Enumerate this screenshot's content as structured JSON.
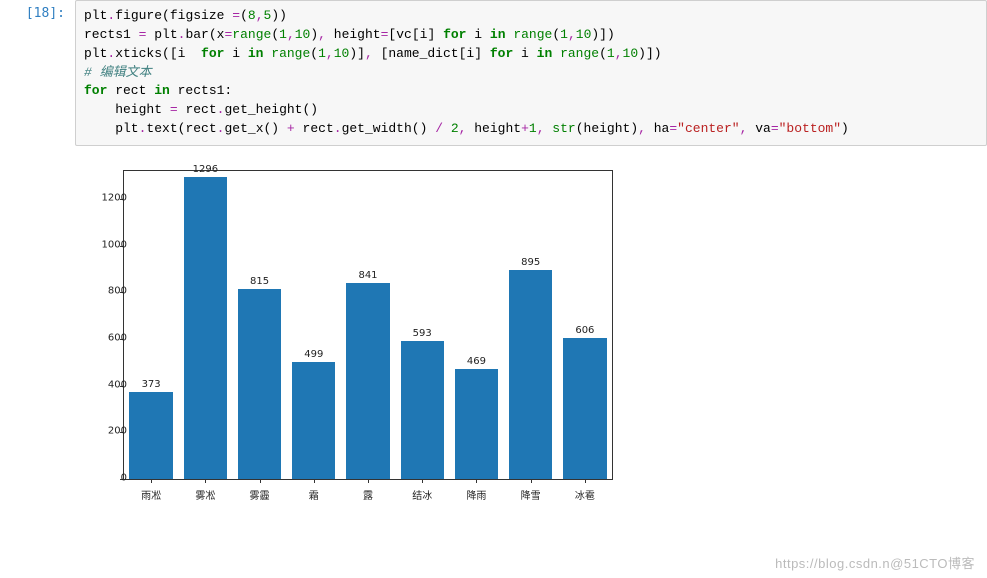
{
  "cell": {
    "prompt": "[18]:",
    "code_tokens": [
      [
        [
          "nm",
          "plt"
        ],
        [
          "op",
          "."
        ],
        [
          "fn",
          "figure"
        ],
        [
          "paren",
          "("
        ],
        [
          "nm",
          "figsize "
        ],
        [
          "op",
          "="
        ],
        [
          "paren",
          "("
        ],
        [
          "num",
          "8"
        ],
        [
          "op",
          ","
        ],
        [
          "num",
          "5"
        ],
        [
          "paren",
          "))"
        ]
      ],
      [
        [
          "nm",
          "rects1 "
        ],
        [
          "op",
          "="
        ],
        [
          "nm",
          " plt"
        ],
        [
          "op",
          "."
        ],
        [
          "fn",
          "bar"
        ],
        [
          "paren",
          "("
        ],
        [
          "nm",
          "x"
        ],
        [
          "op",
          "="
        ],
        [
          "builtin",
          "range"
        ],
        [
          "paren",
          "("
        ],
        [
          "num",
          "1"
        ],
        [
          "op",
          ","
        ],
        [
          "num",
          "10"
        ],
        [
          "paren",
          ")"
        ],
        [
          "op",
          ", "
        ],
        [
          "nm",
          "height"
        ],
        [
          "op",
          "="
        ],
        [
          "paren",
          "["
        ],
        [
          "nm",
          "vc"
        ],
        [
          "paren",
          "["
        ],
        [
          "nm",
          "i"
        ],
        [
          "paren",
          "]"
        ],
        [
          "nm",
          " "
        ],
        [
          "kw",
          "for"
        ],
        [
          "nm",
          " i "
        ],
        [
          "kw",
          "in"
        ],
        [
          "nm",
          " "
        ],
        [
          "builtin",
          "range"
        ],
        [
          "paren",
          "("
        ],
        [
          "num",
          "1"
        ],
        [
          "op",
          ","
        ],
        [
          "num",
          "10"
        ],
        [
          "paren",
          ")])"
        ]
      ],
      [
        [
          "nm",
          "plt"
        ],
        [
          "op",
          "."
        ],
        [
          "fn",
          "xticks"
        ],
        [
          "paren",
          "(["
        ],
        [
          "nm",
          "i  "
        ],
        [
          "kw",
          "for"
        ],
        [
          "nm",
          " i "
        ],
        [
          "kw",
          "in"
        ],
        [
          "nm",
          " "
        ],
        [
          "builtin",
          "range"
        ],
        [
          "paren",
          "("
        ],
        [
          "num",
          "1"
        ],
        [
          "op",
          ","
        ],
        [
          "num",
          "10"
        ],
        [
          "paren",
          ")]"
        ],
        [
          "op",
          ", "
        ],
        [
          "paren",
          "["
        ],
        [
          "nm",
          "name_dict"
        ],
        [
          "paren",
          "["
        ],
        [
          "nm",
          "i"
        ],
        [
          "paren",
          "]"
        ],
        [
          "nm",
          " "
        ],
        [
          "kw",
          "for"
        ],
        [
          "nm",
          " i "
        ],
        [
          "kw",
          "in"
        ],
        [
          "nm",
          " "
        ],
        [
          "builtin",
          "range"
        ],
        [
          "paren",
          "("
        ],
        [
          "num",
          "1"
        ],
        [
          "op",
          ","
        ],
        [
          "num",
          "10"
        ],
        [
          "paren",
          ")])"
        ]
      ],
      [
        [
          "cmt",
          "# 编辑文本"
        ]
      ],
      [
        [
          "kw",
          "for"
        ],
        [
          "nm",
          " rect "
        ],
        [
          "kw",
          "in"
        ],
        [
          "nm",
          " rects1:"
        ]
      ],
      [
        [
          "nm",
          "    height "
        ],
        [
          "op",
          "="
        ],
        [
          "nm",
          " rect"
        ],
        [
          "op",
          "."
        ],
        [
          "fn",
          "get_height"
        ],
        [
          "paren",
          "()"
        ]
      ],
      [
        [
          "nm",
          "    plt"
        ],
        [
          "op",
          "."
        ],
        [
          "fn",
          "text"
        ],
        [
          "paren",
          "("
        ],
        [
          "nm",
          "rect"
        ],
        [
          "op",
          "."
        ],
        [
          "fn",
          "get_x"
        ],
        [
          "paren",
          "()"
        ],
        [
          "nm",
          " "
        ],
        [
          "op",
          "+"
        ],
        [
          "nm",
          " rect"
        ],
        [
          "op",
          "."
        ],
        [
          "fn",
          "get_width"
        ],
        [
          "paren",
          "()"
        ],
        [
          "nm",
          " "
        ],
        [
          "op",
          "/"
        ],
        [
          "nm",
          " "
        ],
        [
          "num",
          "2"
        ],
        [
          "op",
          ", "
        ],
        [
          "nm",
          "height"
        ],
        [
          "op",
          "+"
        ],
        [
          "num",
          "1"
        ],
        [
          "op",
          ", "
        ],
        [
          "builtin",
          "str"
        ],
        [
          "paren",
          "("
        ],
        [
          "nm",
          "height"
        ],
        [
          "paren",
          ")"
        ],
        [
          "op",
          ", "
        ],
        [
          "nm",
          "ha"
        ],
        [
          "op",
          "="
        ],
        [
          "str",
          "\"center\""
        ],
        [
          "op",
          ", "
        ],
        [
          "nm",
          "va"
        ],
        [
          "op",
          "="
        ],
        [
          "str",
          "\"bottom\""
        ],
        [
          "paren",
          ")"
        ]
      ]
    ]
  },
  "chart_data": {
    "type": "bar",
    "categories": [
      "雨凇",
      "雾凇",
      "雾霾",
      "霜",
      "露",
      "结冰",
      "降雨",
      "降雪",
      "冰雹"
    ],
    "values": [
      373,
      1296,
      815,
      499,
      841,
      593,
      469,
      895,
      606
    ],
    "yticks": [
      0,
      200,
      400,
      600,
      800,
      1000,
      1200
    ],
    "ylim": [
      0,
      1320
    ],
    "xlabel": "",
    "ylabel": "",
    "title": ""
  },
  "watermark": "https://blog.csdn.n@51CTO博客"
}
